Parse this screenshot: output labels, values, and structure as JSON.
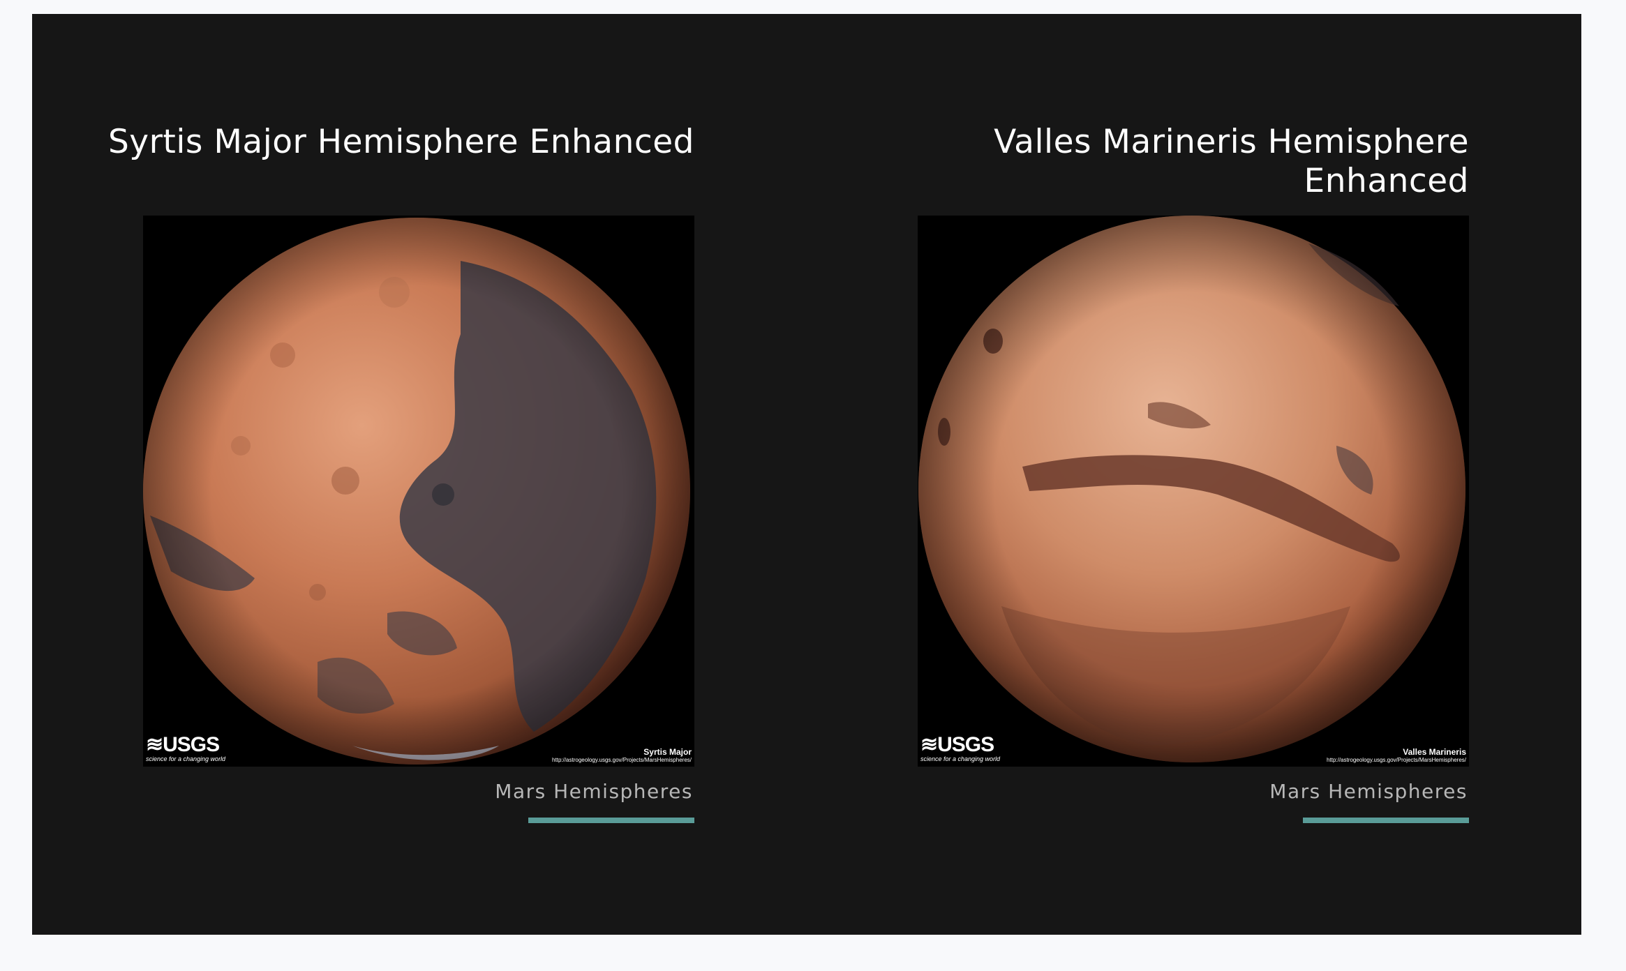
{
  "colors": {
    "page_background": "#f8f9fb",
    "panel_background": "#161616",
    "title_text": "#ffffff",
    "caption_text": "#b7b7b7",
    "accent_bar": "#5a9c98"
  },
  "hemispheres": [
    {
      "title": "Syrtis Major Hemisphere Enhanced",
      "image_label": "Syrtis Major",
      "image_url_text": "http://astrogeology.usgs.gov/Projects/MarsHemispheres/",
      "logo_text": "≋USGS",
      "logo_tagline": "science for a changing world",
      "caption": "Mars Hemispheres"
    },
    {
      "title": "Valles Marineris Hemisphere Enhanced",
      "image_label": "Valles Marineris",
      "image_url_text": "http://astrogeology.usgs.gov/Projects/MarsHemispheres/",
      "logo_text": "≋USGS",
      "logo_tagline": "science for a changing world",
      "caption": "Mars Hemispheres"
    }
  ]
}
